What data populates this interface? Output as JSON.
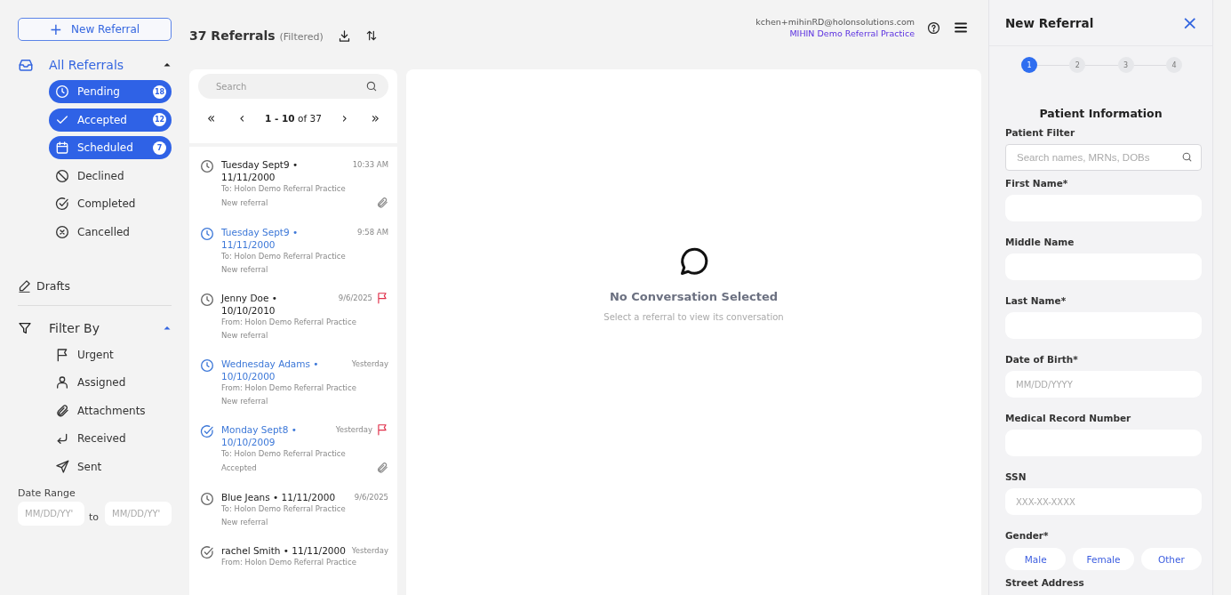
{
  "sidebar": {
    "new_referral_button": {
      "icon": "+",
      "label": "New Referral"
    },
    "all_referrals": {
      "label": "All Referrals",
      "expanded": true,
      "items": [
        {
          "label": "Pending",
          "count": "18",
          "selected": true
        },
        {
          "label": "Accepted",
          "count": "12",
          "selected": true
        },
        {
          "label": "Scheduled",
          "count": "7",
          "selected": true
        },
        {
          "label": "Declined",
          "selected": false
        },
        {
          "label": "Completed",
          "selected": false
        },
        {
          "label": "Cancelled",
          "selected": false
        }
      ]
    },
    "drafts": {
      "label": "Drafts"
    },
    "filter_by": {
      "label": "Filter By",
      "expanded": true,
      "items": [
        {
          "label": "Urgent"
        },
        {
          "label": "Assigned"
        },
        {
          "label": "Attachments"
        },
        {
          "label": "Received"
        },
        {
          "label": "Sent"
        }
      ]
    },
    "date_range": {
      "label": "Date Range",
      "from": {
        "placeholder": "MM/DD/YY'"
      },
      "separator": "to",
      "to": {
        "placeholder": "MM/DD/YY'"
      }
    }
  },
  "list_header": {
    "title": "37 Referrals",
    "note": "(Filtered)"
  },
  "user": {
    "email": "kchen+mihinRD@holonsolutions.com",
    "practice": "MIHIN Demo Referral Practice"
  },
  "referral_list": {
    "search": {
      "placeholder": "Search"
    },
    "pagination": {
      "first": "«",
      "prev": "‹",
      "range": "**1 - 10** of 37",
      "next": "›",
      "last": "»"
    },
    "items": [
      {
        "kind": "pending",
        "title": "Tuesday Sept9 • 11/11/2000",
        "party": "To: Holon Demo Referral Practice",
        "status": "New referral",
        "time": "10:33 AM",
        "unread": false,
        "flagged": false,
        "attachment": true
      },
      {
        "kind": "pending",
        "title": "Tuesday Sept9 • 11/11/2000",
        "party": "To: Holon Demo Referral Practice",
        "status": "New referral",
        "time": "9:58 AM",
        "unread": true,
        "flagged": false,
        "attachment": false
      },
      {
        "kind": "pending",
        "title": "Jenny Doe • 10/10/2010",
        "party": "From: Holon Demo Referral Practice",
        "status": "New referral",
        "time": "9/6/2025",
        "unread": false,
        "flagged": true,
        "attachment": false
      },
      {
        "kind": "pending",
        "title": "Wednesday Adams • 10/10/2000",
        "party": "From: Holon Demo Referral Practice",
        "status": "New referral",
        "time": "Yesterday",
        "unread": true,
        "flagged": false,
        "attachment": false
      },
      {
        "kind": "accepted",
        "title": "Monday Sept8 • 10/10/2009",
        "party": "To: Holon Demo Referral Practice",
        "status": "Accepted",
        "time": "Yesterday",
        "unread": true,
        "flagged": true,
        "attachment": true
      },
      {
        "kind": "pending",
        "title": "Blue Jeans • 11/11/2000",
        "party": "To: Holon Demo Referral Practice",
        "status": "New referral",
        "time": "9/6/2025",
        "unread": false,
        "flagged": false,
        "attachment": false
      },
      {
        "kind": "accepted",
        "title": "rachel Smith • 11/11/2000",
        "party": "From: Holon Demo Referral Practice",
        "time": "Yesterday",
        "unread": false,
        "flagged": false,
        "attachment": false
      }
    ]
  },
  "conversation": {
    "title": "No Conversation Selected",
    "subtitle": "Select a referral to view its conversation"
  },
  "new_referral_panel": {
    "title": "New Referral",
    "close": "×",
    "steps": [
      {
        "label": "1",
        "selected": true
      },
      {
        "label": "2",
        "selected": false
      },
      {
        "label": "3",
        "selected": false
      },
      {
        "label": "4",
        "selected": false
      }
    ],
    "section_title": "Patient Information",
    "fields": [
      {
        "kind": "search",
        "label": "Patient Filter",
        "placeholder": "Search names, MRNs, DOBs"
      },
      {
        "kind": "text",
        "label": "First Name*"
      },
      {
        "kind": "text",
        "label": "Middle Name"
      },
      {
        "kind": "text",
        "label": "Last Name*"
      },
      {
        "kind": "text",
        "label": "Date of Birth*",
        "placeholder": "MM/DD/YYYY"
      },
      {
        "kind": "text",
        "label": "Medical Record Number"
      },
      {
        "kind": "text",
        "label": "SSN",
        "placeholder": "XXX-XX-XXXX"
      }
    ],
    "gender": {
      "label": "Gender*",
      "options": [
        {
          "label": "Male",
          "selected": false
        },
        {
          "label": "Female",
          "selected": false
        },
        {
          "label": "Other",
          "selected": false
        }
      ]
    },
    "next_label": "Street Address"
  }
}
